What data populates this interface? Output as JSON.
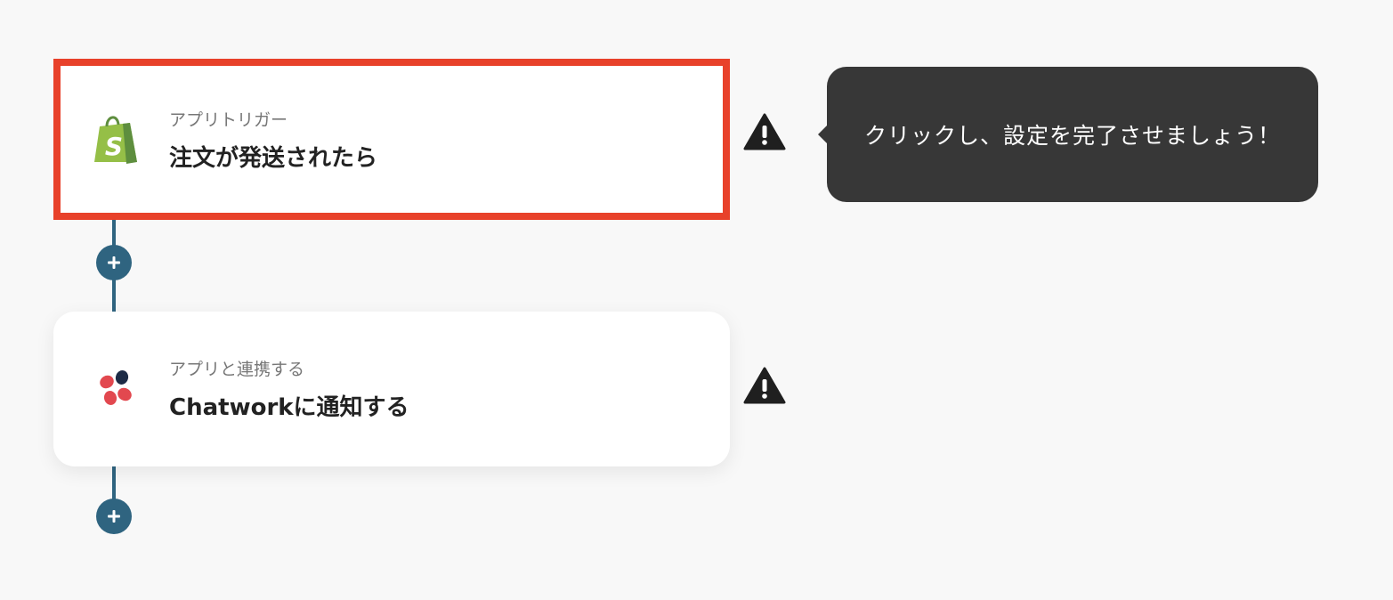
{
  "steps": [
    {
      "caption": "アプリトリガー",
      "title": "注文が発送されたら",
      "app_icon": "shopify-icon",
      "selected": true,
      "warning": true
    },
    {
      "caption": "アプリと連携する",
      "title": "Chatworkに通知する",
      "app_icon": "chatwork-icon",
      "selected": false,
      "warning": true
    }
  ],
  "tooltip": {
    "text": "クリックし、設定を完了させましょう！"
  },
  "add_buttons": [
    {
      "icon": "plus-icon"
    },
    {
      "icon": "plus-icon"
    }
  ],
  "colors": {
    "background": "#f8f8f8",
    "accent": "#2f6480",
    "selection_border": "#e8412a",
    "tooltip_bg": "#373737",
    "shopify_green": "#95bf47",
    "chatwork_red": "#e2484f",
    "chatwork_navy": "#1d2b46"
  }
}
